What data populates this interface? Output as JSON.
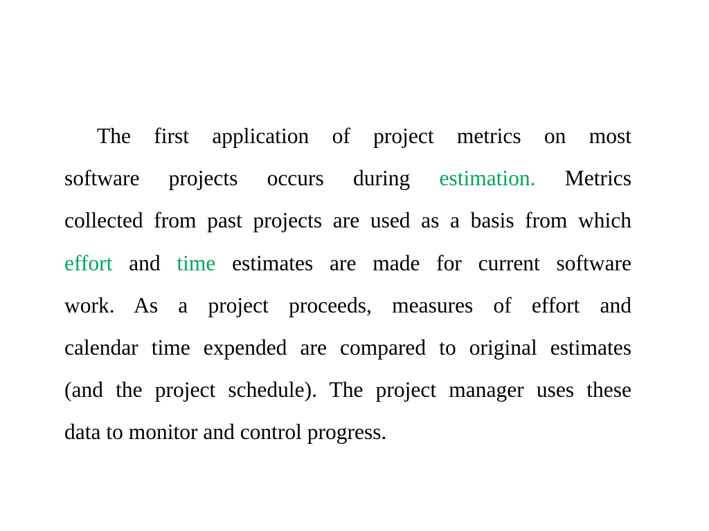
{
  "slide": {
    "background_color": "#ffffff",
    "text_color": "#000000",
    "highlight_color": "#00a65a",
    "paragraph_full_text": "The first application of project metrics on most software projects occurs during estimation. Metrics collected from past projects are used as a basis from which effort and time estimates are made for current software work. As a project proceeds, measures of effort and calendar time expended are compared to original estimates (and the project schedule). The project manager uses these data to monitor and control progress.",
    "highlighted_terms": [
      "estimation",
      "effort",
      "time"
    ],
    "lines": [
      {
        "index": 1,
        "segments": [
          {
            "text": "The first application of project metrics on most",
            "color": "black"
          }
        ]
      },
      {
        "index": 2,
        "segments": [
          {
            "text": "software projects occurs during ",
            "color": "black"
          },
          {
            "text": "estimation.",
            "color": "green"
          },
          {
            "text": " Metrics",
            "color": "black"
          }
        ]
      },
      {
        "index": 3,
        "segments": [
          {
            "text": "collected from past projects are used as a basis from which",
            "color": "black"
          }
        ]
      },
      {
        "index": 4,
        "segments": [
          {
            "text": "effort",
            "color": "green"
          },
          {
            "text": " and ",
            "color": "black"
          },
          {
            "text": "time",
            "color": "green"
          },
          {
            "text": " estimates are made for current software",
            "color": "black"
          }
        ]
      },
      {
        "index": 5,
        "segments": [
          {
            "text": "work. As a project proceeds, measures of effort and",
            "color": "black"
          }
        ]
      },
      {
        "index": 6,
        "segments": [
          {
            "text": "calendar time expended are compared to original estimates",
            "color": "black"
          }
        ]
      },
      {
        "index": 7,
        "segments": [
          {
            "text": "(and the project schedule). The project manager uses these",
            "color": "black"
          }
        ]
      },
      {
        "index": 8,
        "segments": [
          {
            "text": "data to monitor and control progress.",
            "color": "black"
          }
        ]
      }
    ],
    "line_1": {
      "part_1": "The first application of project metrics on most"
    },
    "line_2": {
      "part_1": "software projects occurs during ",
      "part_2_green": "estimation.",
      "part_3": " Metrics"
    },
    "line_3": {
      "part_1": "collected from past projects are used as a basis from which"
    },
    "line_4": {
      "part_1_green": "effort",
      "part_2": " and ",
      "part_3_green": "time",
      "part_4": " estimates are made for current software"
    },
    "line_5": {
      "part_1": "work. As a project proceeds, measures of effort and"
    },
    "line_6": {
      "part_1": "calendar time expended are compared to original estimates"
    },
    "line_7": {
      "part_1": "(and the project schedule). The project manager uses these"
    },
    "line_8": {
      "part_1": "data to monitor and control progress."
    }
  }
}
